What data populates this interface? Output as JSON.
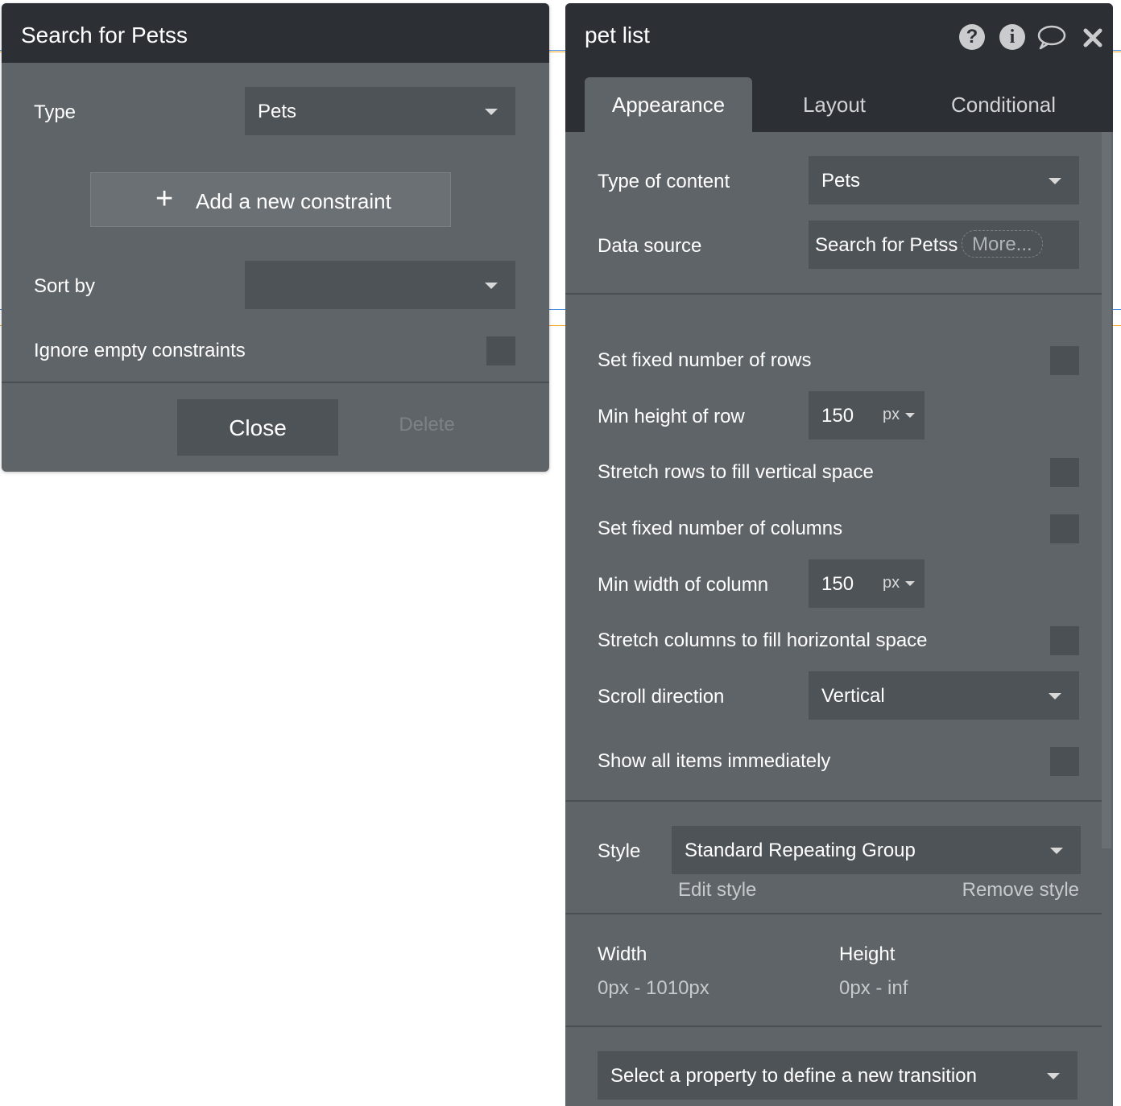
{
  "search_panel": {
    "title": "Search for Petss",
    "type_label": "Type",
    "type_value": "Pets",
    "add_constraint_label": "Add a new constraint",
    "add_constraint_icon": "plus-icon",
    "sort_by_label": "Sort by",
    "sort_by_value": "",
    "ignore_empty_label": "Ignore empty constraints",
    "close_label": "Close",
    "delete_label": "Delete"
  },
  "editor": {
    "title": "pet list",
    "header_icons": [
      "help-icon",
      "info-icon",
      "comment-icon",
      "close-icon"
    ],
    "tabs": [
      {
        "label": "Appearance",
        "active": true
      },
      {
        "label": "Layout",
        "active": false
      },
      {
        "label": "Conditional",
        "active": false
      }
    ],
    "type_of_content_label": "Type of content",
    "type_of_content_value": "Pets",
    "data_source_label": "Data source",
    "data_source_value": "Search for Petss",
    "data_source_more": "More...",
    "fixed_rows_label": "Set fixed number of rows",
    "min_row_height_label": "Min height of row",
    "min_row_height_value": "150",
    "min_row_height_unit": "px",
    "stretch_rows_label": "Stretch rows to fill vertical space",
    "fixed_columns_label": "Set fixed number of columns",
    "min_col_width_label": "Min width of column",
    "min_col_width_value": "150",
    "min_col_width_unit": "px",
    "stretch_cols_label": "Stretch columns to fill horizontal space",
    "scroll_direction_label": "Scroll direction",
    "scroll_direction_value": "Vertical",
    "show_all_label": "Show all items immediately",
    "style_label": "Style",
    "style_value": "Standard Repeating Group",
    "edit_style_label": "Edit style",
    "remove_style_label": "Remove style",
    "width_label": "Width",
    "width_value": "0px - 1010px",
    "height_label": "Height",
    "height_value": "0px - inf",
    "transition_placeholder": "Select a property to define a new transition"
  },
  "colors": {
    "panel_bg": "#5f6468",
    "header_bg": "#2c3035",
    "field_bg": "#4e5357",
    "data_source_accent": "#f5a623"
  }
}
